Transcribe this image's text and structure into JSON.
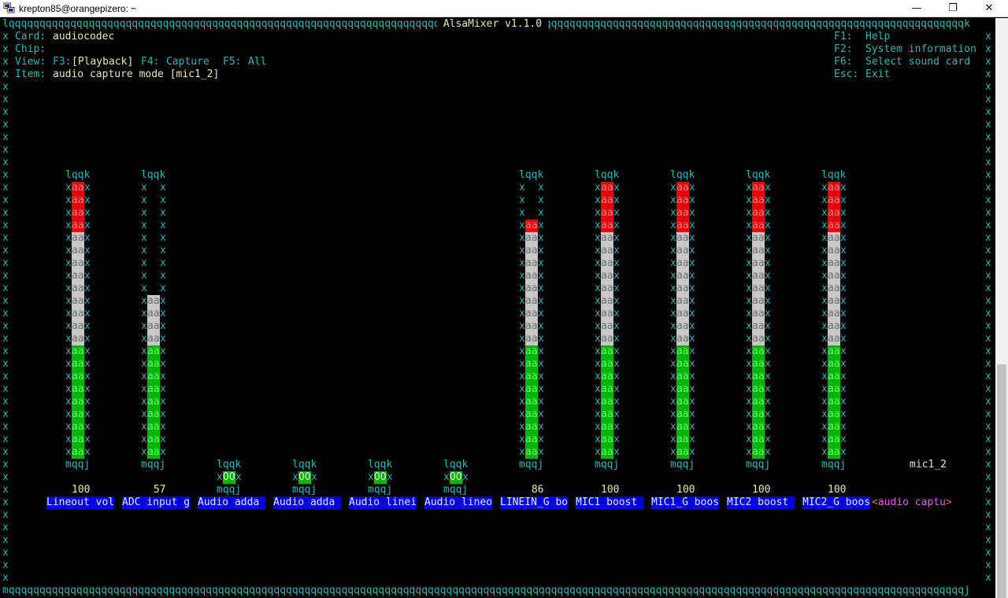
{
  "window": {
    "title": "krepton85@orangepizero: ~",
    "min_glyph": "—",
    "max_glyph": "❐",
    "close_glyph": "✕",
    "app_icon": "putty-icon"
  },
  "header": {
    "title": " AlsaMixer v1.1.0 ",
    "card_label": "Card:",
    "card_value": "audiocodec",
    "chip_label": "Chip:",
    "view_label": "View:",
    "view_f3_key": "F3:",
    "view_f3": "[Playback]",
    "view_f4_key": "F4:",
    "view_f4": "Capture",
    "view_f5_key": "F5:",
    "view_f5": "All",
    "item_label": "Item:",
    "item_value": "audio capture mode [mic1_2]"
  },
  "help": [
    {
      "key": "F1:",
      "text": "Help"
    },
    {
      "key": "F2:",
      "text": "System information"
    },
    {
      "key": "F6:",
      "text": "Select sound card"
    },
    {
      "key": "Esc:",
      "text": "Exit"
    }
  ],
  "palette": {
    "frame": "#2fb4b4",
    "label_bg": "#0000e0",
    "meter_red": "#e00000",
    "meter_white": "#c8c8c8",
    "meter_green": "#00b400",
    "selected_label": "#e85ae8"
  },
  "controls": [
    {
      "label": "Lineout vol",
      "type": "slider",
      "value_text": "100",
      "level": 100
    },
    {
      "label": "ADC input g",
      "type": "slider",
      "value_text": "57",
      "level": 57
    },
    {
      "label": "Audio adda ",
      "type": "switch",
      "switch_text": "OO"
    },
    {
      "label": "Audio adda ",
      "type": "switch",
      "switch_text": "OO"
    },
    {
      "label": "Audio linei",
      "type": "switch",
      "switch_text": "OO"
    },
    {
      "label": "Audio lineo",
      "type": "switch",
      "switch_text": "OO"
    },
    {
      "label": "LINEIN_G bo",
      "type": "slider",
      "value_text": "86",
      "level": 86
    },
    {
      "label": "MIC1 boost ",
      "type": "slider",
      "value_text": "100",
      "level": 100
    },
    {
      "label": "MIC1_G boos",
      "type": "slider",
      "value_text": "100",
      "level": 100
    },
    {
      "label": "MIC2 boost ",
      "type": "slider",
      "value_text": "100",
      "level": 100
    },
    {
      "label": "MIC2_G boos",
      "type": "slider",
      "value_text": "100",
      "level": 100
    },
    {
      "label": "audio captu",
      "type": "enum",
      "enum_value": "mic1_2",
      "selected": true
    }
  ]
}
